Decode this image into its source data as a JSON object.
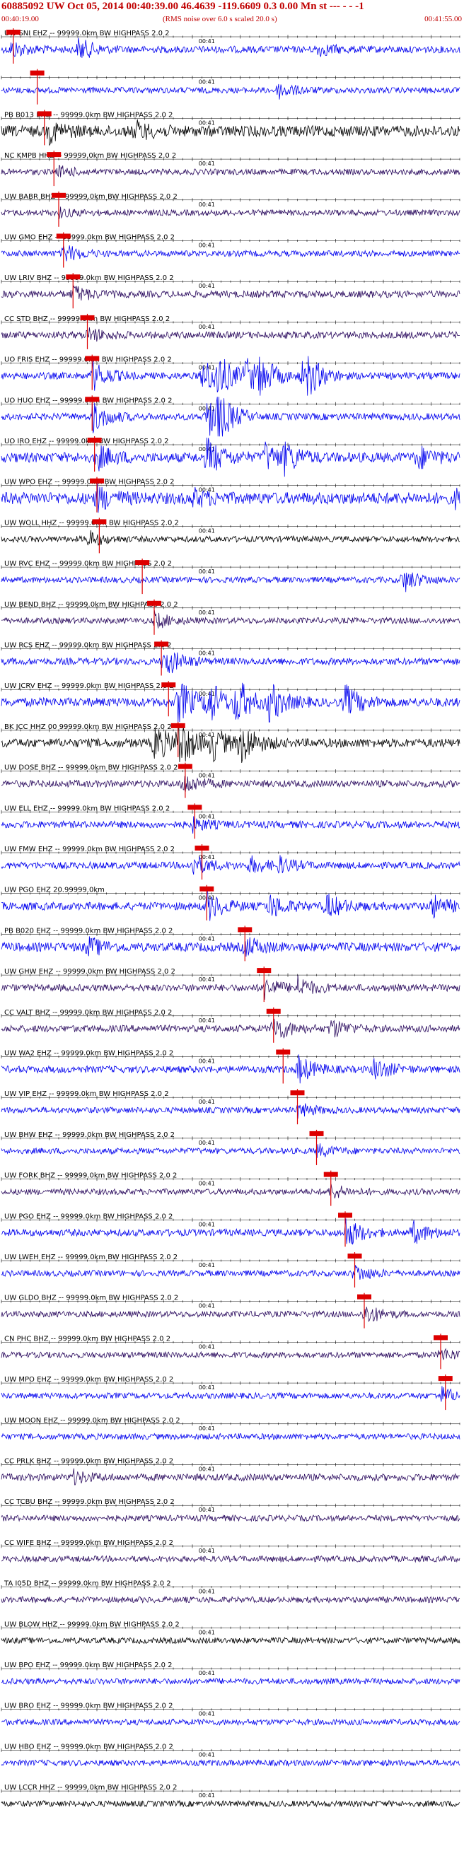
{
  "header": {
    "title": "60885092 UW Oct 05, 2014 00:40:39.00   46.4639 -119.6609  0.3 0.00 Mn st --- - -  -1",
    "rms_note": "(RMS noise over 6.0 s scaled 20.0 s)",
    "time_start": "00:40:19.00",
    "time_end": "00:41:55.00"
  },
  "colors": {
    "blue": "#0000ee",
    "black": "#000000",
    "purple": "#2a0a5e",
    "pick": "#dd0000",
    "axis": "#000000"
  },
  "chart_data": {
    "type": "line",
    "title": "60885092 UW Oct 05, 2014 00:40:39.00   46.4639 -119.6609  0.3 0.00 Mn st --- - -  -1",
    "xlabel": "",
    "ylabel": "",
    "x_range": [
      "00:40:19.00",
      "00:41:55.00"
    ],
    "x_range_seconds": [
      0,
      96
    ],
    "minute_tick_label": "00:41",
    "minute_tick_second": 41,
    "series": [
      {
        "name": "UW SNI EHZ",
        "label": "UW SNI EHZ -- 99999.0km BW  HIGHPASS  2.0  2",
        "color": "blue",
        "amp": 0.35,
        "pick": 2.5,
        "events": [
          [
            2,
            0.8
          ],
          [
            16,
            1.1
          ],
          [
            66,
            0.6
          ]
        ]
      },
      {
        "name": "UW SNI EHZ",
        "label": "",
        "color": "blue",
        "amp": 0.3,
        "pick": 7.5,
        "events": [
          [
            58,
            0.8
          ]
        ]
      },
      {
        "name": "PB B013 EHZ",
        "label": "PB B013 EHZ -- 99999.0km BW  HIGHPASS  2.0  2",
        "color": "black",
        "amp": 0.55,
        "pick": 9,
        "events": [
          [
            10,
            0.9
          ],
          [
            28,
            0.8
          ]
        ]
      },
      {
        "name": "NC KMPB HHZ",
        "label": "NC KMPB HHZ -- 99999.0km BW  HIGHPASS  2.0  2",
        "color": "purple",
        "amp": 0.3,
        "pick": 11,
        "events": [
          [
            12,
            0.5
          ]
        ]
      },
      {
        "name": "UW BABR BHZ",
        "label": "UW BABR BHZ -- 99999.0km BW  HIGHPASS  2.0  2",
        "color": "purple",
        "amp": 0.3,
        "pick": 12,
        "events": [
          [
            12,
            0.4
          ]
        ]
      },
      {
        "name": "UW GMO EHZ",
        "label": "UW GMO EHZ -- 99999.0km BW  HIGHPASS  2.0  2",
        "color": "blue",
        "amp": 0.3,
        "pick": 13,
        "events": [
          [
            13,
            0.9
          ]
        ]
      },
      {
        "name": "UW LRIV BHZ",
        "label": "UW LRIV BHZ -- 99999.0km BW  HIGHPASS  2.0  2",
        "color": "purple",
        "amp": 0.35,
        "pick": 15,
        "events": [
          [
            15,
            0.8
          ]
        ]
      },
      {
        "name": "CC STD BHZ",
        "label": "CC STD BHZ -- 99999.0km BW  HIGHPASS  2.0  2",
        "color": "purple",
        "amp": 0.35,
        "pick": 18,
        "events": [
          [
            18,
            0.7
          ]
        ]
      },
      {
        "name": "UO FRIS EHZ",
        "label": "UO FRIS EHZ -- 99999.0km BW  HIGHPASS  2.0  2",
        "color": "blue",
        "amp": 0.35,
        "pick": 19,
        "events": [
          [
            19,
            1.4
          ],
          [
            42,
            1.8
          ],
          [
            45,
            1.8
          ],
          [
            51,
            1.6
          ],
          [
            54,
            1.6
          ],
          [
            63,
            1.3
          ],
          [
            64,
            1.2
          ]
        ]
      },
      {
        "name": "UO HUO EHZ",
        "label": "UO HUO EHZ -- 99999.0km BW  HIGHPASS  2.0  2",
        "color": "blue",
        "amp": 0.35,
        "pick": 19,
        "events": [
          [
            19,
            1.5
          ],
          [
            43,
            2
          ],
          [
            45,
            1.8
          ]
        ]
      },
      {
        "name": "UO IRO EHZ",
        "label": "UO IRO EHZ -- 99999.0km BW  HIGHPASS  2.0  2",
        "color": "blue",
        "amp": 0.5,
        "pick": 19.5,
        "events": [
          [
            20,
            1.1
          ],
          [
            43,
            1.8
          ],
          [
            55,
            1.3
          ],
          [
            59,
            1.3
          ],
          [
            87,
            1.1
          ]
        ]
      },
      {
        "name": "UW WPO EHZ",
        "label": "UW WPO EHZ -- 99999.0km BW  HIGHPASS  2.0  2",
        "color": "blue",
        "amp": 0.6,
        "pick": 20,
        "events": [
          [
            20,
            1.1
          ],
          [
            40,
            0.7
          ],
          [
            95,
            0.7
          ]
        ]
      },
      {
        "name": "UW WOLL HHZ",
        "label": "UW WOLL HHZ -- 99999.0km BW  HIGHPASS  2.0  2",
        "color": "black",
        "amp": 0.3,
        "pick": 20.5,
        "events": [
          [
            18,
            0.8
          ]
        ]
      },
      {
        "name": "UW RVC EHZ",
        "label": "UW RVC EHZ -- 99999.0km BW  HIGHPASS  2.0  2",
        "color": "blue",
        "amp": 0.3,
        "pick": 29.5,
        "events": [
          [
            84,
            1.2
          ]
        ]
      },
      {
        "name": "UW BEND BHZ",
        "label": "UW BEND BHZ -- 99999.0km BW  HIGHPASS  2.0  2",
        "color": "purple",
        "amp": 0.3,
        "pick": 32,
        "events": [
          [
            32,
            0.8
          ]
        ]
      },
      {
        "name": "UW RCS EHZ",
        "label": "UW RCS EHZ -- 99999.0km BW  HIGHPASS  2.0  2",
        "color": "blue",
        "amp": 0.35,
        "pick": 33.5,
        "events": [
          [
            34,
            1.5
          ]
        ]
      },
      {
        "name": "UW JCRV EHZ",
        "label": "UW JCRV EHZ -- 99999.0km BW  HIGHPASS  2.0  2",
        "color": "blue",
        "amp": 0.45,
        "pick": 35,
        "events": [
          [
            37,
            2.2
          ],
          [
            43,
            2.2
          ],
          [
            49,
            2.2
          ],
          [
            56,
            1.8
          ],
          [
            72,
            1.5
          ]
        ]
      },
      {
        "name": "BK JCC HHZ",
        "label": "BK JCC HHZ 00 99999.0km BW  HIGHPASS  2.0  2",
        "color": "black",
        "amp": 0.45,
        "pick": 37,
        "events": [
          [
            32,
            1.8
          ],
          [
            37,
            2.2
          ],
          [
            44,
            1.6
          ],
          [
            50,
            2
          ]
        ]
      },
      {
        "name": "UW DOSE BHZ",
        "label": "UW DOSE BHZ -- 99999.0km BW  HIGHPASS  2.0  2",
        "color": "purple",
        "amp": 0.35,
        "pick": 38.5,
        "events": [
          [
            38,
            1
          ]
        ]
      },
      {
        "name": "UW ELL EHZ",
        "label": "UW ELL EHZ -- 99999.0km BW  HIGHPASS  2.0  2",
        "color": "blue",
        "amp": 0.35,
        "pick": 40.5,
        "events": [
          [
            40,
            0.6
          ]
        ]
      },
      {
        "name": "UW FMW EHZ",
        "label": "UW FMW EHZ -- 99999.0km BW  HIGHPASS  2.0  2",
        "color": "blue",
        "amp": 0.35,
        "pick": 42,
        "events": [
          [
            40,
            1
          ],
          [
            52,
            0.8
          ],
          [
            58,
            0.7
          ]
        ]
      },
      {
        "name": "UW PGO EHZ",
        "label": "UW PGO EHZ 20.99999.0km",
        "color": "blue",
        "amp": 0.4,
        "pick": 43,
        "events": [
          [
            43,
            1.4
          ],
          [
            56,
            1.2
          ],
          [
            68,
            1.2
          ],
          [
            90,
            1.1
          ]
        ]
      },
      {
        "name": "PB B020 EHZ",
        "label": "PB B020 EHZ -- 99999.0km BW  HIGHPASS  2.0  2",
        "color": "blue",
        "amp": 0.45,
        "pick": 51,
        "events": [
          [
            18,
            0.9
          ],
          [
            51,
            0.9
          ]
        ]
      },
      {
        "name": "UW GHW EHZ",
        "label": "UW GHW EHZ -- 99999.0km BW  HIGHPASS  2.0  2",
        "color": "purple",
        "amp": 0.35,
        "pick": 55,
        "events": [
          [
            55,
            1
          ],
          [
            62,
            1
          ]
        ]
      },
      {
        "name": "CC VALT BHZ",
        "label": "CC VALT BHZ -- 99999.0km BW  HIGHPASS  2.0  2",
        "color": "purple",
        "amp": 0.35,
        "pick": 57,
        "events": [
          [
            57,
            1.3
          ],
          [
            69,
            0.9
          ]
        ]
      },
      {
        "name": "UW WA2 EHZ",
        "label": "UW WA2 EHZ -- 99999.0km BW  HIGHPASS  2.0  2",
        "color": "blue",
        "amp": 0.35,
        "pick": 59,
        "events": [
          [
            62,
            1.4
          ],
          [
            78,
            1.1
          ]
        ]
      },
      {
        "name": "UW VIP EHZ",
        "label": "UW VIP EHZ -- 99999.0km BW  HIGHPASS  2.0  2",
        "color": "blue",
        "amp": 0.3,
        "pick": 62,
        "events": [
          [
            62,
            0.7
          ]
        ]
      },
      {
        "name": "UW BHW EHZ",
        "label": "UW BHW EHZ -- 99999.0km BW  HIGHPASS  2.0  2",
        "color": "blue",
        "amp": 0.3,
        "pick": 66,
        "events": [
          [
            66,
            0.6
          ]
        ]
      },
      {
        "name": "UW FORK BHZ",
        "label": "UW FORK BHZ -- 99999.0km BW  HIGHPASS  2.0  2",
        "color": "purple",
        "amp": 0.3,
        "pick": 69,
        "events": [
          [
            69,
            0.7
          ]
        ]
      },
      {
        "name": "UW PGO EHZ",
        "label": "UW PGO EHZ -- 99999.0km BW  HIGHPASS  2.0  2",
        "color": "blue",
        "amp": 0.35,
        "pick": 72,
        "events": [
          [
            72,
            1.5
          ],
          [
            86,
            1.1
          ]
        ]
      },
      {
        "name": "UW LWEH EHZ",
        "label": "UW LWEH EHZ -- 99999.0km BW  HIGHPASS  2.0  2",
        "color": "blue",
        "amp": 0.3,
        "pick": 74,
        "events": [
          [
            74,
            0.8
          ]
        ]
      },
      {
        "name": "UW GLDO BHZ",
        "label": "UW GLDO BHZ -- 99999.0km BW  HIGHPASS  2.0  2",
        "color": "purple",
        "amp": 0.3,
        "pick": 76,
        "events": [
          [
            76,
            1
          ]
        ]
      },
      {
        "name": "CN PHC BHZ",
        "label": "CN PHC BHZ -- 99999.0km BW  HIGHPASS  2.0  2",
        "color": "purple",
        "amp": 0.3,
        "pick": 92,
        "events": [
          [
            92,
            0.6
          ]
        ]
      },
      {
        "name": "UW MPO EHZ",
        "label": "UW MPO EHZ -- 99999.0km BW  HIGHPASS  2.0  2",
        "color": "blue",
        "amp": 0.3,
        "pick": 93,
        "events": [
          [
            92,
            0.8
          ]
        ]
      },
      {
        "name": "UW MOON EHZ",
        "label": "UW MOON EHZ -- 99999.0km BW  HIGHPASS  2.0  2",
        "color": "blue",
        "amp": 0.3,
        "pick": null,
        "events": []
      },
      {
        "name": "CC PRLK BHZ",
        "label": "CC PRLK BHZ -- 99999.0km BW  HIGHPASS  2.0  2",
        "color": "purple",
        "amp": 0.35,
        "pick": null,
        "events": [
          [
            15,
            0.6
          ]
        ]
      },
      {
        "name": "CC TCBU BHZ",
        "label": "CC TCBU BHZ -- 99999.0km BW  HIGHPASS  2.0  2",
        "color": "purple",
        "amp": 0.3,
        "pick": null,
        "events": []
      },
      {
        "name": "CC WIFE BHZ",
        "label": "CC WIFE BHZ -- 99999.0km BW  HIGHPASS  2.0  2",
        "color": "purple",
        "amp": 0.3,
        "pick": null,
        "events": []
      },
      {
        "name": "TA I05D BHZ",
        "label": "TA I05D BHZ -- 99999.0km BW  HIGHPASS  2.0  2",
        "color": "purple",
        "amp": 0.3,
        "pick": null,
        "events": []
      },
      {
        "name": "UW BLOW HHZ",
        "label": "UW BLOW HHZ -- 99999.0km BW  HIGHPASS  2.0  2",
        "color": "black",
        "amp": 0.3,
        "pick": null,
        "events": []
      },
      {
        "name": "UW BPO EHZ",
        "label": "UW BPO EHZ -- 99999.0km BW  HIGHPASS  2.0  2",
        "color": "blue",
        "amp": 0.3,
        "pick": null,
        "events": []
      },
      {
        "name": "UW BRO EHZ",
        "label": "UW BRO EHZ -- 99999.0km BW  HIGHPASS  2.0  2",
        "color": "blue",
        "amp": 0.3,
        "pick": null,
        "events": []
      },
      {
        "name": "UW HBO EHZ",
        "label": "UW HBO EHZ -- 99999.0km BW  HIGHPASS  2.0  2",
        "color": "blue",
        "amp": 0.3,
        "pick": null,
        "events": []
      },
      {
        "name": "UW LCCR HHZ",
        "label": "UW LCCR HHZ -- 99999.0km BW  HIGHPASS  2.0  2",
        "color": "black",
        "amp": 0.3,
        "pick": null,
        "events": []
      }
    ]
  }
}
